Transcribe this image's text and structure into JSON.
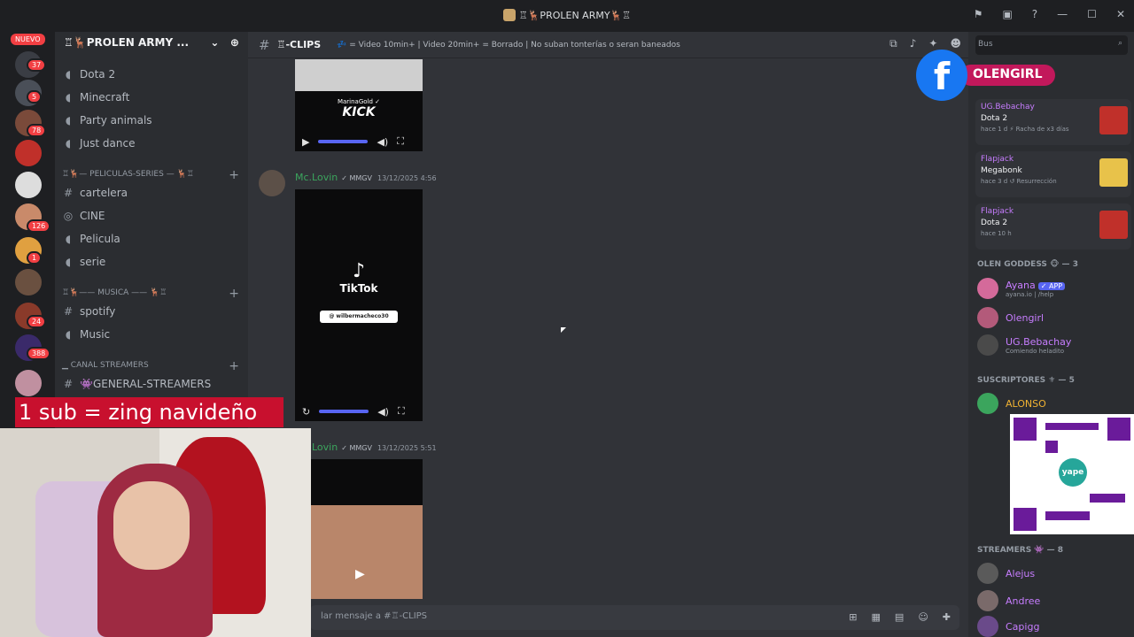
{
  "window": {
    "title": "♖🦌PROLEN ARMY🦌♖",
    "controls": [
      "—",
      "☐",
      "✕"
    ]
  },
  "servers": {
    "nuevo": "NUEVO",
    "badges": [
      "37",
      "5",
      "78",
      "126",
      "1",
      "24",
      "388"
    ]
  },
  "sidebar": {
    "guild_name": "♖🦌PROLEN ARMY ...",
    "voice_top": [
      "Dota 2",
      "Minecraft",
      "Party animals",
      "Just dance"
    ],
    "cat_peliculas": "♖🦌— PELICULAS-SERIES — 🦌♖",
    "peliculas_channels": [
      {
        "icon": "#",
        "label": "cartelera"
      },
      {
        "icon": "◎",
        "label": "CINE"
      },
      {
        "icon": "◖",
        "label": "Pelicula"
      },
      {
        "icon": "◖",
        "label": "serie"
      }
    ],
    "cat_musica": "♖🦌—— MUSICA —— 🦌♖",
    "musica_channels": [
      {
        "icon": "#",
        "label": "spotify"
      },
      {
        "icon": "◖",
        "label": "Music"
      }
    ],
    "cat_streamers": "▁ CANAL STREAMERS",
    "streamers_channel": "👾GENERAL-STREAMERS"
  },
  "channel": {
    "name": "♖-CLIPS",
    "topic": "💤 = Video 10min+ | Video 20min+ = Borrado | No suban tonterías o seran baneados"
  },
  "messages": [
    {
      "author": "Mc.Lovin",
      "tag": "✓ MMGV",
      "time": "13/12/2025 4:56"
    },
    {
      "author": "Lovin",
      "tag": "✓ MMGV",
      "time": "13/12/2025 5:51"
    }
  ],
  "video1": {
    "brand": "MarinaGold ✓",
    "logo": "KICK"
  },
  "video2": {
    "brand": "TikTok",
    "search": "@ wilbermacheco30"
  },
  "composer": {
    "placeholder": "lar mensaje a #♖-CLIPS"
  },
  "right": {
    "search_placeholder": "Bus",
    "activities": [
      {
        "user": "UG.Bebachay",
        "game": "Dota 2",
        "meta": "hace 1 d  ⚡ Racha de x3 días"
      },
      {
        "user": "Flapjack",
        "game": "Megabonk",
        "meta": "hace 3 d  ↺ Resurrección"
      },
      {
        "user": "Flapjack",
        "game": "Dota 2",
        "meta": "hace 10 h"
      }
    ],
    "group1": "OLEN GODDESS 🐵 — 3",
    "group1_members": [
      {
        "name": "Ayana",
        "sub": "ayana.io | /help",
        "badge": "✓ APP",
        "color": "#c77dff"
      },
      {
        "name": "Olengirl",
        "sub": "",
        "badge": "",
        "color": "#c77dff"
      },
      {
        "name": "UG.Bebachay",
        "sub": "Comiendo heladito",
        "badge": "",
        "color": "#c77dff"
      }
    ],
    "group2": "SUSCRIPTORES ⚜ — 5",
    "group2_members": [
      {
        "name": "ALONSO",
        "color": "#f0b232"
      }
    ],
    "group3": "STREAMERS 👾 — 8",
    "group3_members": [
      {
        "name": "Alejus",
        "color": "#c77dff"
      },
      {
        "name": "Andree",
        "color": "#c77dff"
      },
      {
        "name": "Capigg",
        "color": "#c77dff"
      }
    ]
  },
  "overlay": {
    "sub_banner": "1 sub = zing navideño",
    "facebook_name": "OLENGIRL",
    "qr_label": "yape"
  }
}
